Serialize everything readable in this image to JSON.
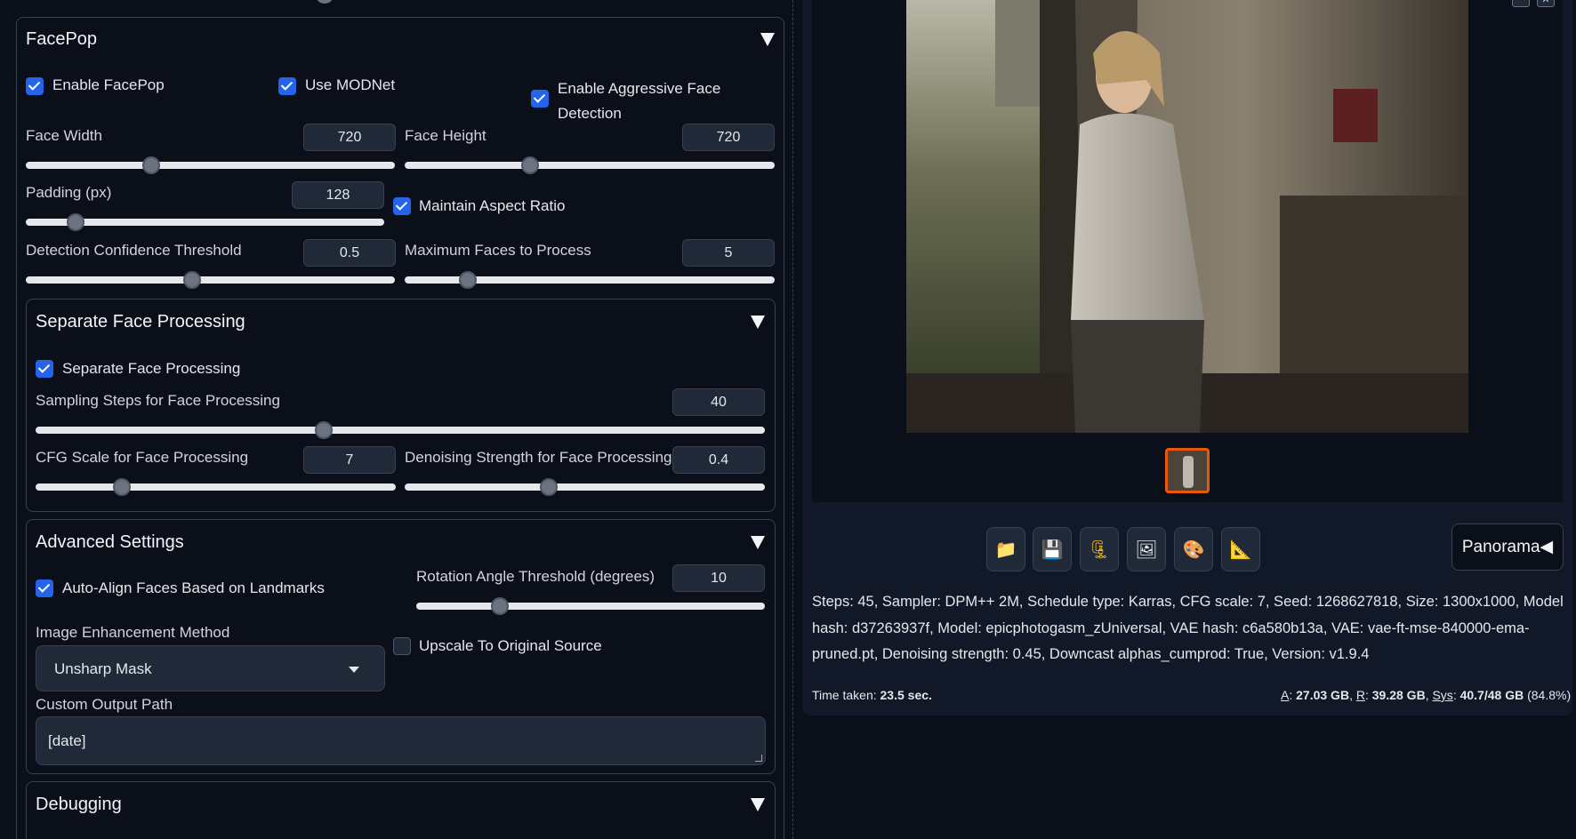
{
  "facepop": {
    "title": "FacePop",
    "enable_label": "Enable FacePop",
    "modnet_label": "Use MODNet",
    "aggressive_label": "Enable Aggressive Face Detection",
    "face_width_label": "Face Width",
    "face_width": "720",
    "face_width_frac": 0.34,
    "face_height_label": "Face Height",
    "face_height": "720",
    "face_height_frac": 0.34,
    "padding_label": "Padding (px)",
    "padding": "128",
    "padding_frac": 0.14,
    "maintain_aspect_label": "Maintain Aspect Ratio",
    "confidence_label": "Detection Confidence Threshold",
    "confidence": "0.5",
    "confidence_frac": 0.45,
    "max_faces_label": "Maximum Faces to Process",
    "max_faces": "5",
    "max_faces_frac": 0.17
  },
  "separate": {
    "title": "Separate Face Processing",
    "checkbox_label": "Separate Face Processing",
    "steps_label": "Sampling Steps for Face Processing",
    "steps": "40",
    "steps_frac": 0.395,
    "cfg_label": "CFG Scale for Face Processing",
    "cfg": "7",
    "cfg_frac": 0.24,
    "denoise_label": "Denoising Strength for Face Processing",
    "denoise": "0.4",
    "denoise_frac": 0.4
  },
  "advanced": {
    "title": "Advanced Settings",
    "autoalign_label": "Auto-Align Faces Based on Landmarks",
    "rotation_label": "Rotation Angle Threshold (degrees)",
    "rotation": "10",
    "rotation_frac": 0.24,
    "enhance_label": "Image Enhancement Method",
    "enhance_value": "Unsharp Mask",
    "upscale_label": "Upscale To Original Source",
    "output_path_label": "Custom Output Path",
    "output_path": "[date]"
  },
  "debugging": {
    "title": "Debugging"
  },
  "output": {
    "panorama_label": "Panorama◀",
    "info_text": "Steps: 45, Sampler: DPM++ 2M, Schedule type: Karras, CFG scale: 7, Seed: 1268627818, Size: 1300x1000, Model hash: d37263937f, Model: epicphotogasm_zUniversal, VAE hash: c6a580b13a, VAE: vae-ft-mse-840000-ema-pruned.pt, Denoising strength: 0.45, Downcast alphas_cumprod: True, Version: v1.9.4",
    "time_label": "Time taken:",
    "time_value": "23.5 sec.",
    "mem_a_label": "A",
    "mem_a": "27.03 GB",
    "mem_r_label": "R",
    "mem_r": "39.28 GB",
    "mem_sys_label": "Sys",
    "mem_sys": "40.7/48 GB",
    "mem_pct": "(84.8%)"
  },
  "colors": {
    "accent_checkbox": "#2563eb",
    "thumb_border": "#ea580c",
    "background": "#0b0f19"
  }
}
